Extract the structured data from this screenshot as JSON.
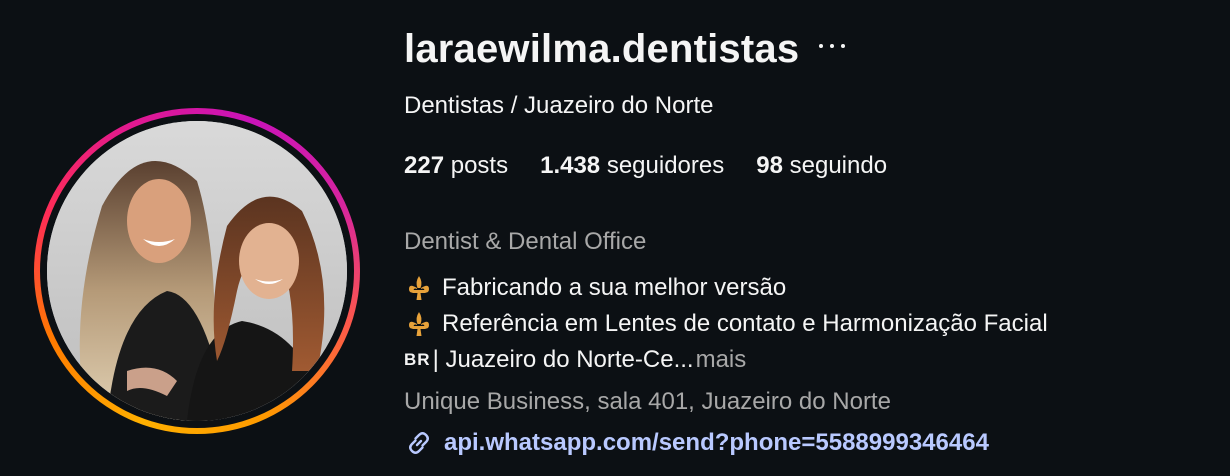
{
  "profile": {
    "username": "laraewilma.dentistas",
    "display_name": "Dentistas / Juazeiro do Norte",
    "stats": {
      "posts_count": "227",
      "posts_label": "posts",
      "followers_count": "1.438",
      "followers_label": "seguidores",
      "following_count": "98",
      "following_label": "seguindo"
    },
    "category": "Dentist & Dental Office",
    "bio": {
      "line1": "Fabricando a sua melhor versão",
      "line2": "Referência em Lentes de contato e Harmonização Facial",
      "line3_flag": "BR",
      "line3_text": "| Juazeiro do Norte-Ce...",
      "more_label": "mais"
    },
    "address": "Unique Business, sala 401, Juazeiro do Norte",
    "link": "api.whatsapp.com/send?phone=5588999346464",
    "colors": {
      "background": "#0c1014",
      "text": "#f5f5f5",
      "secondary_text": "#a8a8a8",
      "link": "#b9c9ff",
      "bullet_icon": "#e8a23a"
    },
    "icons": [
      "more-options-icon",
      "fleur-de-lis-icon",
      "link-icon"
    ]
  }
}
